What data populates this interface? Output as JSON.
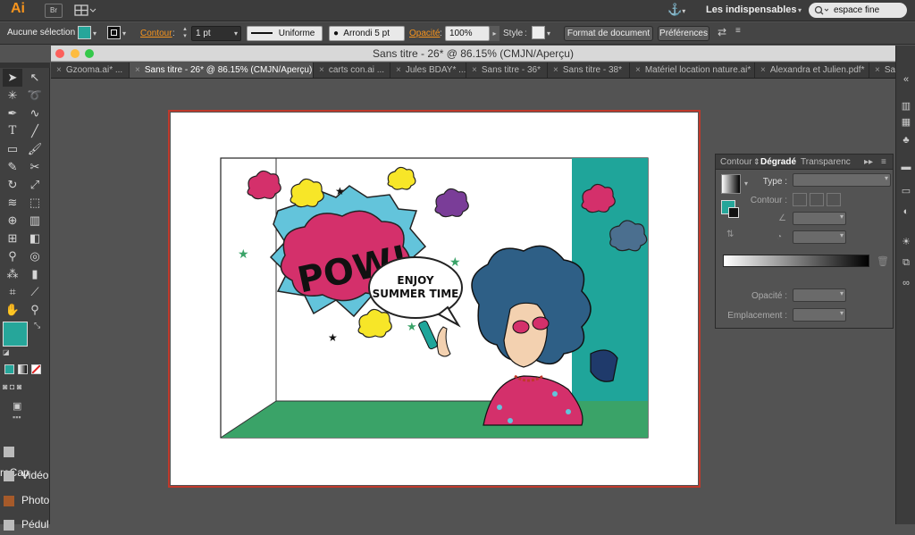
{
  "app": {
    "logo": "Ai",
    "bridge_button": "Br",
    "workspace_label": "Les indispensables",
    "search_value": "espace fine"
  },
  "control_bar": {
    "selection_label": "Aucune sélection",
    "stroke_label": "Contour",
    "stroke_weight": "1 pt",
    "profile_label": "Uniforme",
    "brush_label": "Arrondi 5 pt",
    "opacity_label": "Opacité",
    "opacity_value": "100%",
    "style_label": "Style",
    "document_format_button": "Format de document",
    "preferences_button": "Préférences",
    "fill_color": "#26a69a"
  },
  "window": {
    "title": "Sans titre - 26* @ 86.15% (CMJN/Aperçu)"
  },
  "tabs": [
    {
      "label": "Gzooma.ai* ..."
    },
    {
      "label": "Sans titre - 26* @ 86.15% (CMJN/Aperçu)"
    },
    {
      "label": "carts con.ai ..."
    },
    {
      "label": "Jules BDAY* ..."
    },
    {
      "label": "Sans titre - 36*"
    },
    {
      "label": "Sans titre - 38*"
    },
    {
      "label": "Matériel location nature.ai*"
    },
    {
      "label": "Alexandra et Julien.pdf*"
    },
    {
      "label": "Sans"
    }
  ],
  "artwork": {
    "pow_text": "POW!",
    "bubble_line1": "ENJOY",
    "bubble_line2": "SUMMER TIME",
    "colors": {
      "teal": "#1fa59a",
      "green": "#3aa368",
      "pink": "#d4306b",
      "yellow": "#f7e628",
      "purple": "#7a3d98",
      "steel_blue": "#4b6f8f",
      "light_blue": "#63c4db"
    }
  },
  "gradient_panel": {
    "tabs": [
      "Contour",
      "Dégradé",
      "Transparenc"
    ],
    "type_label": "Type :",
    "stroke_label": "Contour :",
    "opacity_label": "Opacité :",
    "location_label": "Emplacement :"
  },
  "dock": {
    "items": [
      "reCap",
      "Vidéo",
      "Photo",
      "Pédul"
    ]
  },
  "icons": [
    "selection-tool-icon",
    "direct-selection-tool-icon",
    "magic-wand-icon",
    "lasso-icon",
    "pen-icon",
    "curvature-icon",
    "type-icon",
    "line-icon",
    "rectangle-icon",
    "paintbrush-icon",
    "pencil-icon",
    "scissors-icon",
    "rotate-icon",
    "scale-icon",
    "warp-icon",
    "free-transform-icon",
    "shape-builder-icon",
    "perspective-grid-icon",
    "mesh-icon",
    "gradient-icon",
    "eyedropper-icon",
    "blend-icon",
    "symbol-sprayer-icon",
    "graph-icon",
    "artboard-icon",
    "slice-icon",
    "hand-icon",
    "zoom-icon"
  ]
}
